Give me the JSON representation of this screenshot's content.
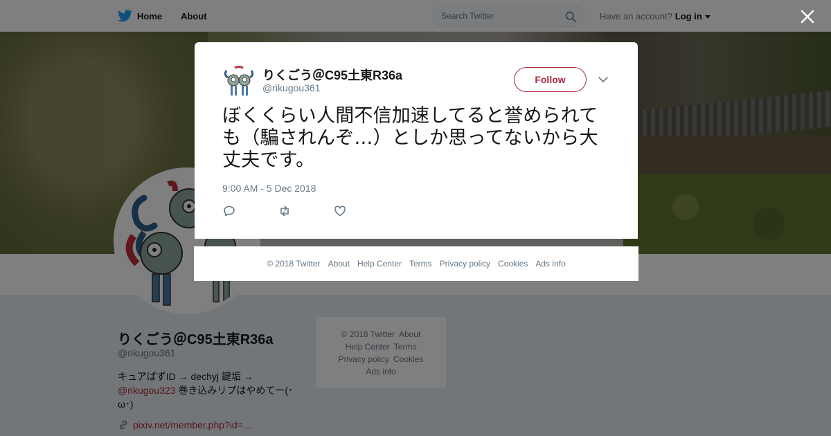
{
  "colors": {
    "accent": "#ab2b3f",
    "twitter_blue": "#1da1f2",
    "muted": "#657786",
    "text": "#14171a"
  },
  "topnav": {
    "home_label": "Home",
    "about_label": "About",
    "search_placeholder": "Search Twitter",
    "account_prompt": "Have an account?",
    "login_label": "Log in"
  },
  "profile": {
    "name": "りくごう＠C95土東R36a",
    "handle": "@rikugou361",
    "bio_before": "キュアぱずID → dechyj 鍵垢 → ",
    "bio_mention": "@rikugou323",
    "bio_after": " 巻き込みリプはやめてー(･ω･)",
    "link": "pixiv.net/member.php?id=…"
  },
  "sidebar_footer": {
    "copyright": "© 2018 Twitter",
    "about": "About",
    "help": "Help Center",
    "terms": "Terms",
    "privacy": "Privacy policy",
    "cookies": "Cookies",
    "ads": "Ads info"
  },
  "tweet": {
    "author_name": "りくごう＠C95土東R36a",
    "author_handle": "@rikugou361",
    "follow_label": "Follow",
    "text": "ぼくくらい人間不信加速してると誉められても（騙されんぞ…）としか思ってないから大丈夫です。",
    "timestamp": "9:00 AM - 5 Dec 2018"
  },
  "overlay_footer": {
    "copyright": "© 2018 Twitter",
    "about": "About",
    "help": "Help Center",
    "terms": "Terms",
    "privacy": "Privacy policy",
    "cookies": "Cookies",
    "ads": "Ads info"
  },
  "icons": [
    "twitter-bird-icon",
    "search-icon",
    "caret-down-icon",
    "close-icon",
    "chevron-down-icon",
    "reply-icon",
    "retweet-icon",
    "like-icon",
    "link-icon"
  ]
}
